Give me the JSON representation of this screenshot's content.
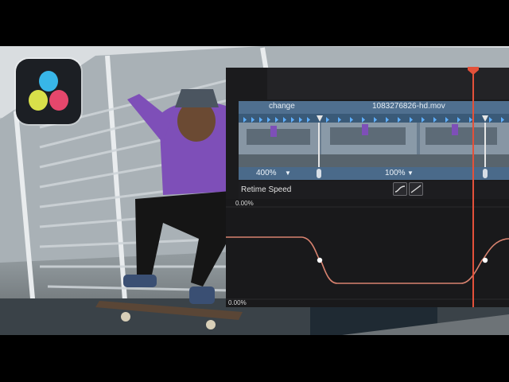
{
  "app": {
    "logo_icon": "davinci-resolve-logo-icon"
  },
  "clip": {
    "speed_change_label": "change",
    "file_name": "1083276826-hd.mov"
  },
  "speed_segments": [
    {
      "label": "400%"
    },
    {
      "label": "100%"
    }
  ],
  "curve_editor": {
    "title": "Retime Speed",
    "top_value": "0.00%",
    "bottom_value": "0.00%",
    "buttons": [
      "ease-in-out-icon",
      "linear-icon"
    ]
  },
  "colors": {
    "playhead": "#e4513a",
    "clip_header": "#4f6f8f",
    "curve": "#d8826f"
  }
}
